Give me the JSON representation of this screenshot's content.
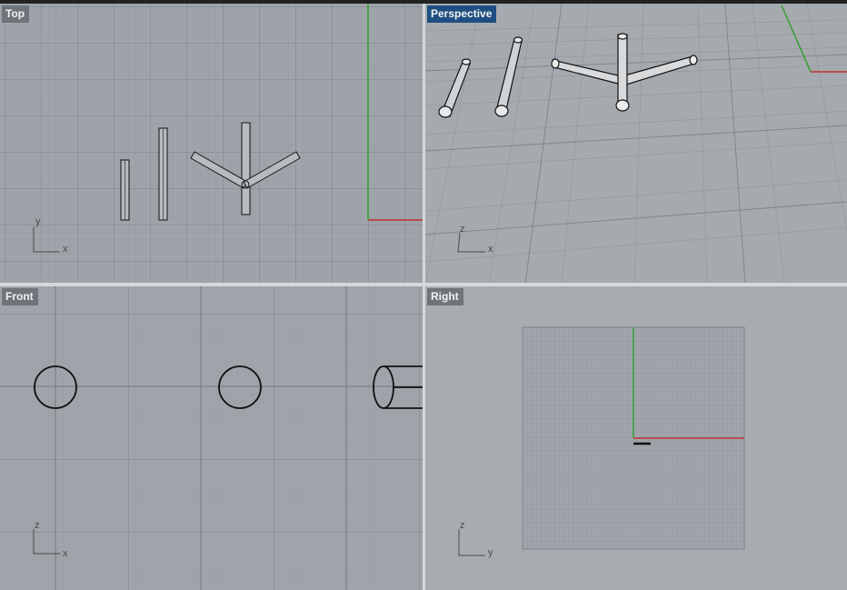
{
  "colors": {
    "active_label_bg": "#1f4f82",
    "inactive_label_bg": "#6f747a",
    "x_axis": "#c03030",
    "y_axis": "#30a030"
  },
  "viewports": {
    "top": {
      "label": "Top",
      "axis_h": "x",
      "axis_v": "y"
    },
    "persp": {
      "label": "Perspective",
      "axis_h": "x",
      "axis_v": "z",
      "active": true
    },
    "front": {
      "label": "Front",
      "axis_h": "x",
      "axis_v": "z"
    },
    "right": {
      "label": "Right",
      "axis_h": "y",
      "axis_v": "z"
    }
  }
}
